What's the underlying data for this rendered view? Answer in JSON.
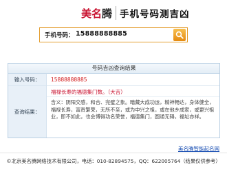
{
  "header": {
    "brand_part1": "美名",
    "brand_part2": "腾",
    "title": "手机号码测吉凶"
  },
  "search": {
    "label": "手机号码：",
    "value": "15888888885",
    "button_icon": "search-icon"
  },
  "result": {
    "panel_title": "号码吉凶查询结果",
    "input_label": "输入号码：",
    "input_value": "15888888885",
    "query_label": "查询结果：",
    "headline": "福禄长寿的福德集门数。",
    "verdict": "（大吉）",
    "detail": "含义：阴阳交感，和合、完璧之象。暗藏大成功运，精神畅达，身体健全，福禄长寿，富贵繁荣，无所不至，或为中兴之祖，或在他乡成家，或更兴祖业，即不如此，也会博得功名荣誉，福德集门，圆通无碍，福址亦祥。"
  },
  "link_text": "美名腾智能起名网",
  "footer_text": "©北京美名腾网络技术有限公司，电话：010-82894575，QQ：622005764（结果仅供参考）"
}
